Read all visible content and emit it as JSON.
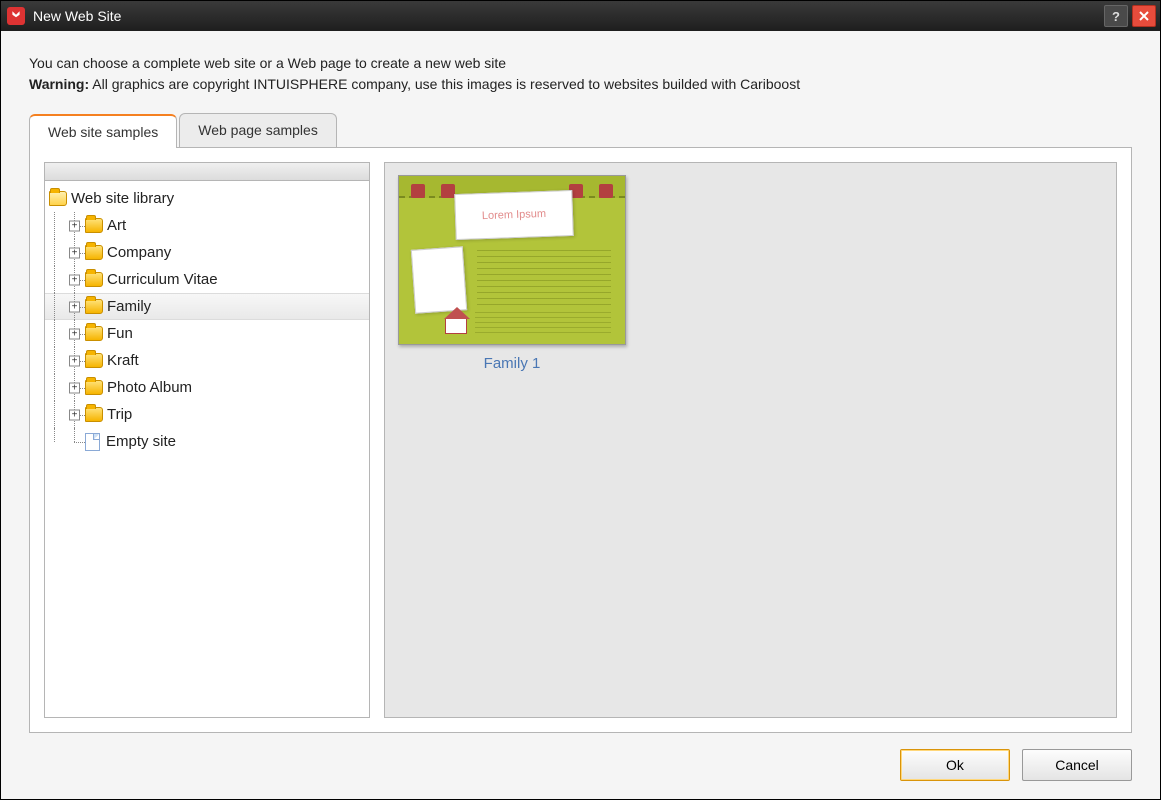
{
  "window": {
    "title": "New Web Site"
  },
  "intro": {
    "line1": "You can choose a complete web site or a Web page to create a new web site",
    "warning_label": "Warning:",
    "warning_text": " All graphics are copyright INTUISPHERE company, use this images is reserved to websites builded with Cariboost"
  },
  "tabs": {
    "site": "Web site samples",
    "page": "Web page samples"
  },
  "tree": {
    "root": "Web site library",
    "items": [
      "Art",
      "Company",
      "Curriculum Vitae",
      "Family",
      "Fun",
      "Kraft",
      "Photo Album",
      "Trip"
    ],
    "empty": "Empty site",
    "selected": "Family"
  },
  "preview": {
    "lorem": "Lorem Ipsum",
    "templates": [
      {
        "label": "Family 1"
      }
    ]
  },
  "buttons": {
    "ok": "Ok",
    "cancel": "Cancel"
  }
}
